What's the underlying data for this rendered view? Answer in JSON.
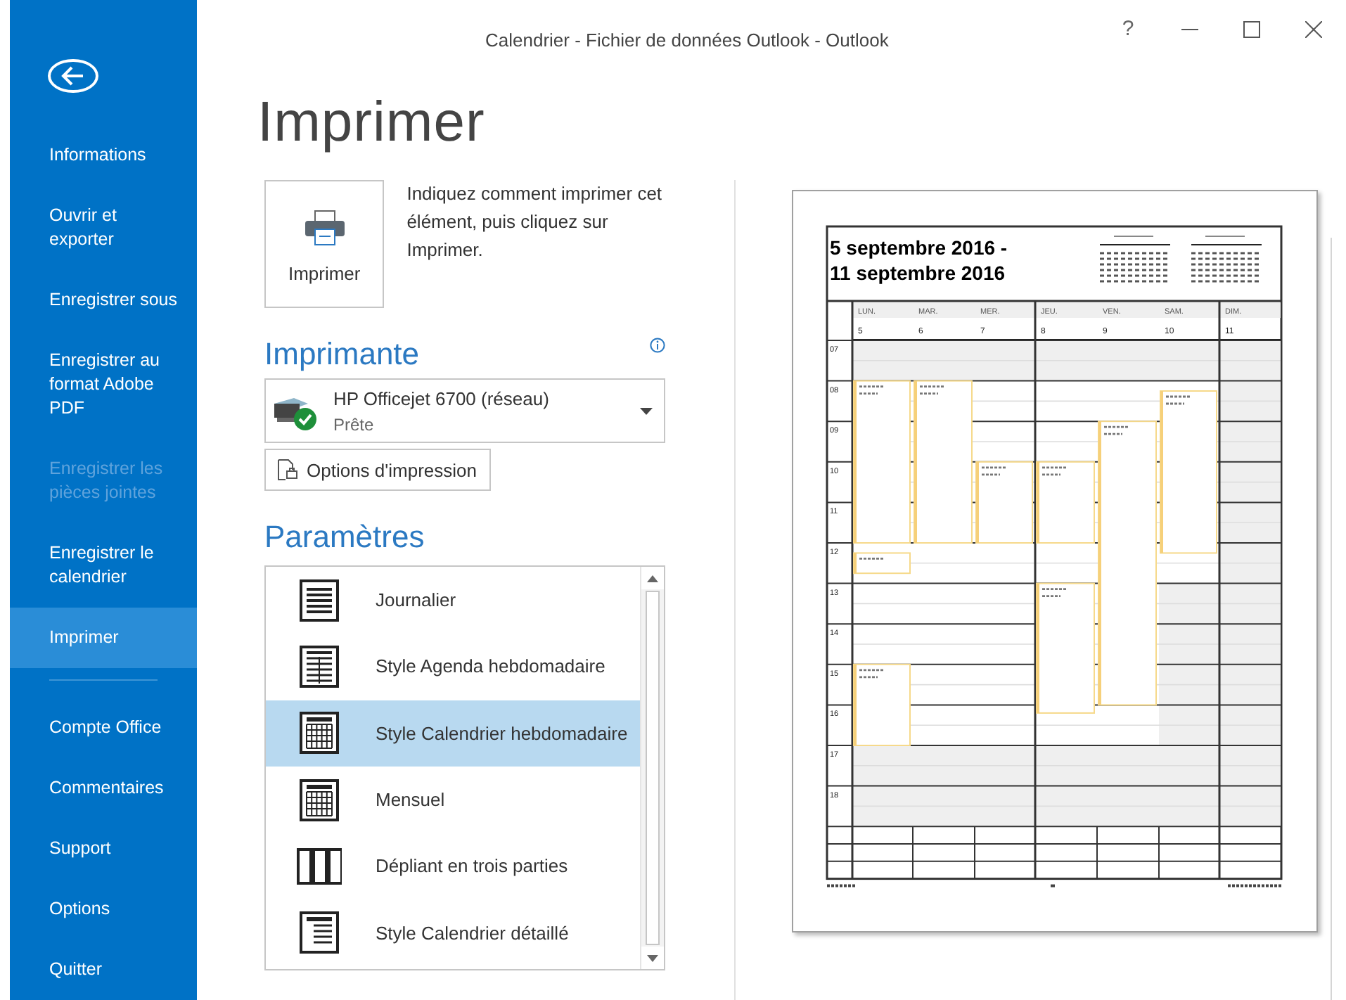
{
  "window": {
    "title": "Calendrier - Fichier de données Outlook - Outlook",
    "controls": [
      "?"
    ]
  },
  "sidebar": {
    "items": [
      {
        "label": "Informations",
        "selected": false,
        "disabled": false
      },
      {
        "label": "Ouvrir et exporter",
        "selected": false,
        "disabled": false
      },
      {
        "label": "Enregistrer sous",
        "selected": false,
        "disabled": false
      },
      {
        "label": "Enregistrer au format Adobe PDF",
        "selected": false,
        "disabled": false
      },
      {
        "label": "Enregistrer les pièces jointes",
        "selected": false,
        "disabled": true
      },
      {
        "label": "Enregistrer le calendrier",
        "selected": false,
        "disabled": false
      },
      {
        "label": "Imprimer",
        "selected": true,
        "disabled": false,
        "divider_after": true
      },
      {
        "label": "Compte Office",
        "selected": false,
        "disabled": false
      },
      {
        "label": "Commentaires",
        "selected": false,
        "disabled": false
      },
      {
        "label": "Support",
        "selected": false,
        "disabled": false
      },
      {
        "label": "Options",
        "selected": false,
        "disabled": false
      },
      {
        "label": "Quitter",
        "selected": false,
        "disabled": false
      }
    ]
  },
  "heading": "Imprimer",
  "print_button": {
    "label": "Imprimer",
    "description": "Indiquez comment imprimer cet élément, puis cliquez sur Imprimer."
  },
  "printer": {
    "heading": "Imprimante",
    "name": "HP Officejet 6700 (réseau)",
    "status": "Prête",
    "options_button": "Options d'impression"
  },
  "settings": {
    "heading": "Paramètres",
    "styles": [
      {
        "label": "Journalier",
        "kind": "daily",
        "selected": false
      },
      {
        "label": "Style Agenda hebdomadaire",
        "kind": "agenda",
        "selected": false
      },
      {
        "label": "Style Calendrier hebdomadaire",
        "kind": "weekcal",
        "selected": true
      },
      {
        "label": "Mensuel",
        "kind": "monthly",
        "selected": false
      },
      {
        "label": "Dépliant en trois parties",
        "kind": "trifold",
        "selected": false
      },
      {
        "label": "Style Calendrier détaillé",
        "kind": "detailed",
        "selected": false
      }
    ]
  },
  "preview": {
    "title_lines": [
      "5 septembre 2016 -",
      "11 septembre 2016"
    ],
    "days": [
      {
        "name": "LUN.",
        "date": "5"
      },
      {
        "name": "MAR.",
        "date": "6"
      },
      {
        "name": "MER.",
        "date": "7"
      },
      {
        "name": "JEU.",
        "date": "8"
      },
      {
        "name": "VEN.",
        "date": "9"
      },
      {
        "name": "SAM.",
        "date": "10"
      },
      {
        "name": "DIM.",
        "date": "11"
      }
    ],
    "hours": [
      "07",
      "08",
      "09",
      "10",
      "11",
      "12",
      "13",
      "14",
      "15",
      "16",
      "17",
      "18"
    ]
  }
}
